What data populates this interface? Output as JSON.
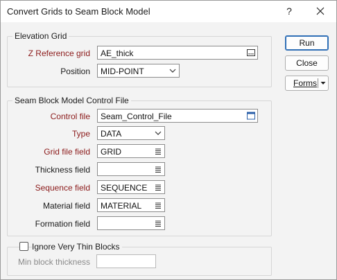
{
  "window": {
    "title": "Convert Grids to Seam Block Model",
    "help_icon": "?",
    "close_icon": "close-icon"
  },
  "elevation_grid": {
    "title": "Elevation Grid",
    "z_reference": {
      "label": "Z Reference grid",
      "value": "AE_thick",
      "icon": "browse-icon"
    },
    "position": {
      "label": "Position",
      "value": "MID-POINT",
      "icon": "chevron-down-icon"
    }
  },
  "control_file": {
    "title": "Seam Block Model Control File",
    "control": {
      "label": "Control file",
      "value": "Seam_Control_File",
      "icon": "file-browse-icon"
    },
    "type": {
      "label": "Type",
      "value": "DATA",
      "icon": "chevron-down-icon"
    },
    "grid_field": {
      "label": "Grid file field",
      "value": "GRID",
      "icon": "list-icon"
    },
    "thickness_field": {
      "label": "Thickness field",
      "value": "",
      "icon": "list-icon"
    },
    "sequence_field": {
      "label": "Sequence field",
      "value": "SEQUENCE",
      "icon": "list-icon"
    },
    "material_field": {
      "label": "Material field",
      "value": "MATERIAL",
      "icon": "list-icon"
    },
    "formation_field": {
      "label": "Formation field",
      "value": "",
      "icon": "list-icon"
    }
  },
  "thin_blocks": {
    "checkbox_label": "Ignore Very Thin Blocks",
    "checked": false,
    "min_thickness": {
      "label": "Min block thickness",
      "value": ""
    }
  },
  "buttons": {
    "run": "Run",
    "close": "Close",
    "forms": "Forms"
  },
  "colors": {
    "required_label": "#8b1a1a",
    "primary_border": "#2f6fb6",
    "background": "#f3f3f3"
  }
}
